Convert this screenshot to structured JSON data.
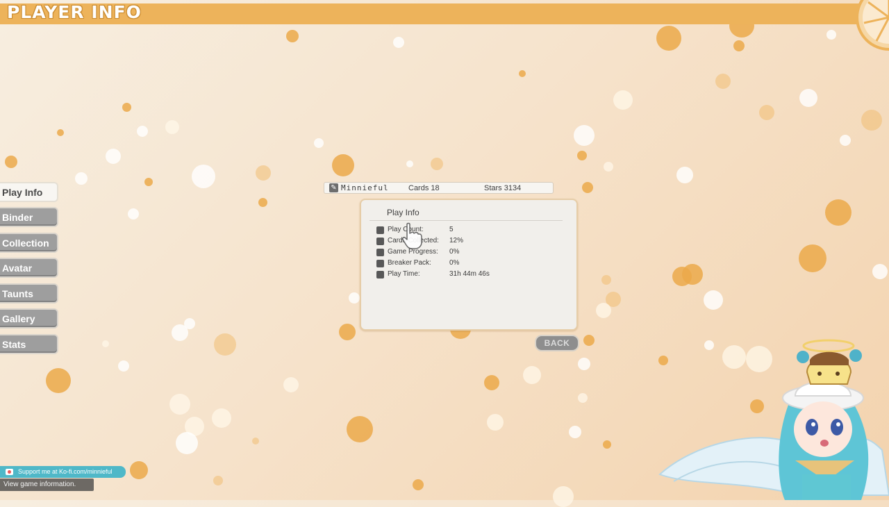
{
  "header": {
    "title": "PLAYER INFO"
  },
  "menu": {
    "items": [
      {
        "label": "Play Info",
        "active": true
      },
      {
        "label": "Binder",
        "active": false
      },
      {
        "label": "Collection",
        "active": false
      },
      {
        "label": "Avatar",
        "active": false
      },
      {
        "label": "Taunts",
        "active": false
      },
      {
        "label": "Gallery",
        "active": false
      },
      {
        "label": "Stats",
        "active": false
      }
    ]
  },
  "player": {
    "name": "Minnieful",
    "cards": "Cards 18",
    "stars": "Stars 3134",
    "icon": "pencil-icon"
  },
  "panel": {
    "title": "Play Info",
    "rows": [
      {
        "label": "Play Count:",
        "value": "5"
      },
      {
        "label": "Cards Collected:",
        "value": "12%"
      },
      {
        "label": "Game Progress:",
        "value": "0%"
      },
      {
        "label": "Breaker Pack:",
        "value": "0%"
      },
      {
        "label": "Play Time:",
        "value": "31h 44m 46s"
      }
    ]
  },
  "back_button": {
    "label": "BACK"
  },
  "footer": {
    "support_text": "Support me at Ko-fi.com/minnieful",
    "hint_text": "View game information."
  },
  "colors": {
    "header": "#edb35b",
    "accent_orange": "#eba94a",
    "button_grey": "#9e9e9e",
    "kofi_teal": "#4fb8c8"
  }
}
